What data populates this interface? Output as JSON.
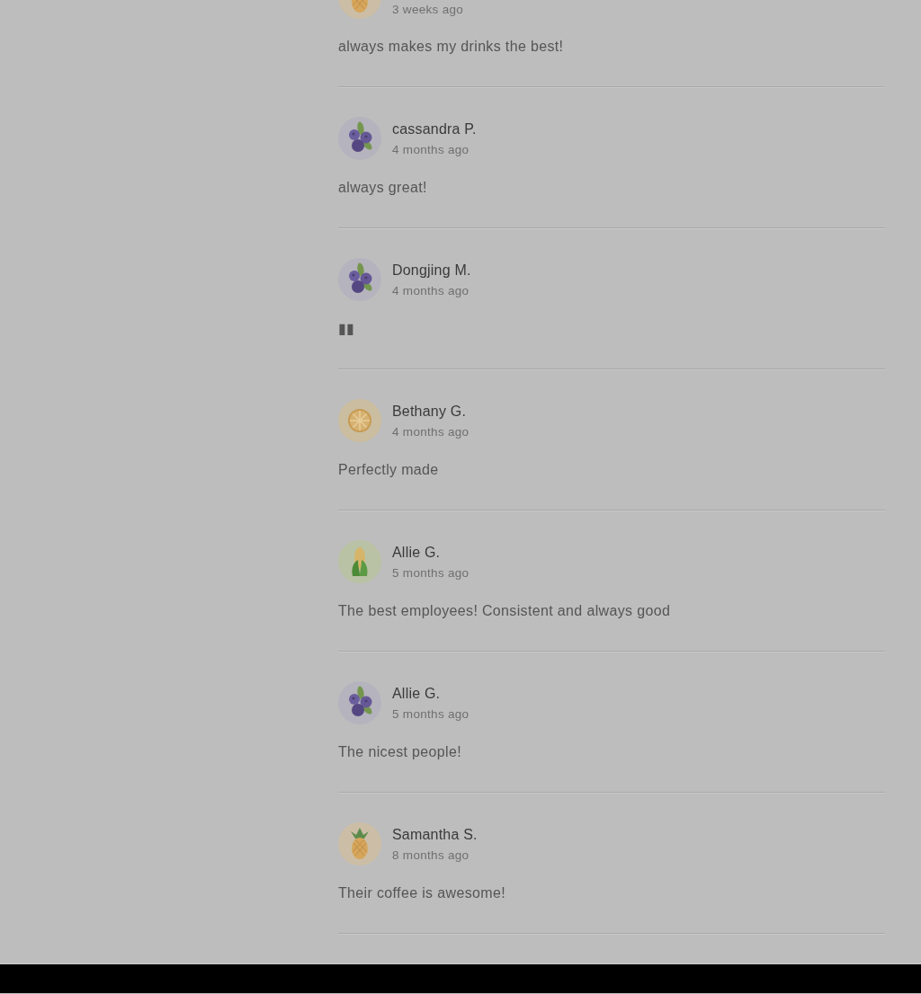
{
  "reviews": [
    {
      "avatar": {
        "kind": "pineapple"
      },
      "cropped": true,
      "date": "3 weeks ago",
      "comment": "always makes my drinks the best!"
    },
    {
      "avatar": {
        "kind": "blueberry"
      },
      "cropped": false,
      "name": "cassandra P.",
      "date": "4 months ago",
      "comment": "always great!"
    },
    {
      "avatar": {
        "kind": "blueberry"
      },
      "cropped": false,
      "name": "Dongjing M.",
      "date": "4 months ago",
      "comment": "▮▮"
    },
    {
      "avatar": {
        "kind": "citrus"
      },
      "cropped": false,
      "name": "Bethany G.",
      "date": "4 months ago",
      "comment": "Perfectly made"
    },
    {
      "avatar": {
        "kind": "corn"
      },
      "cropped": false,
      "name": "Allie G.",
      "date": "5 months ago",
      "comment": "The best employees! Consistent and always good"
    },
    {
      "avatar": {
        "kind": "blueberry"
      },
      "cropped": false,
      "name": "Allie G.",
      "date": "5 months ago",
      "comment": "The nicest people!"
    },
    {
      "avatar": {
        "kind": "pineapple"
      },
      "cropped": false,
      "name": "Samantha S.",
      "date": "8 months ago",
      "comment": "Their coffee is awesome!"
    }
  ]
}
